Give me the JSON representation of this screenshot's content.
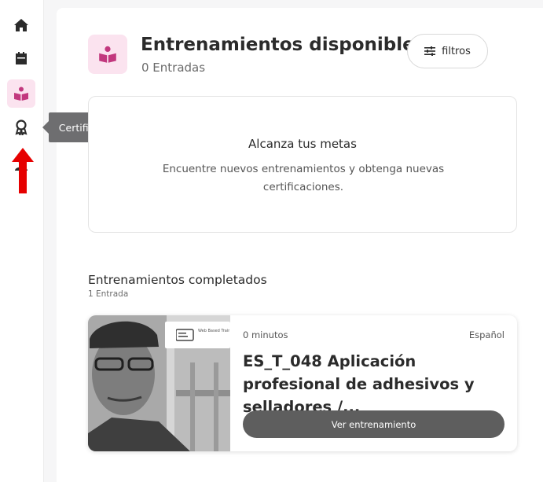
{
  "sidebar": {
    "items": [
      {
        "icon": "home-icon"
      },
      {
        "icon": "calendar-icon"
      },
      {
        "icon": "book-reader-icon",
        "active": true
      },
      {
        "icon": "certificate-award-icon"
      },
      {
        "icon": "user-icon"
      }
    ],
    "tooltip": "Certificados"
  },
  "colors": {
    "accent": "#c2387e",
    "accent_bg": "#fbe3ef",
    "arrow": "#e60000",
    "button": "#5e5e5e"
  },
  "header": {
    "title": "Entrenamientos disponibles",
    "subtitle": "0 Entradas",
    "filter_label": "filtros"
  },
  "empty_state": {
    "title": "Alcanza tus metas",
    "text": "Encuentre nuevos entrenamientos y obtenga nuevas certificaciones."
  },
  "completed": {
    "title": "Entrenamientos completados",
    "count": "1 Entrada",
    "course": {
      "duration": "0 minutos",
      "language": "Español",
      "title": "ES_T_048 Aplicación profesional de adhesivos y selladores /...",
      "button_label": "Ver entrenamiento",
      "thumbnail_label": "Web Based Training Self Learning"
    }
  }
}
